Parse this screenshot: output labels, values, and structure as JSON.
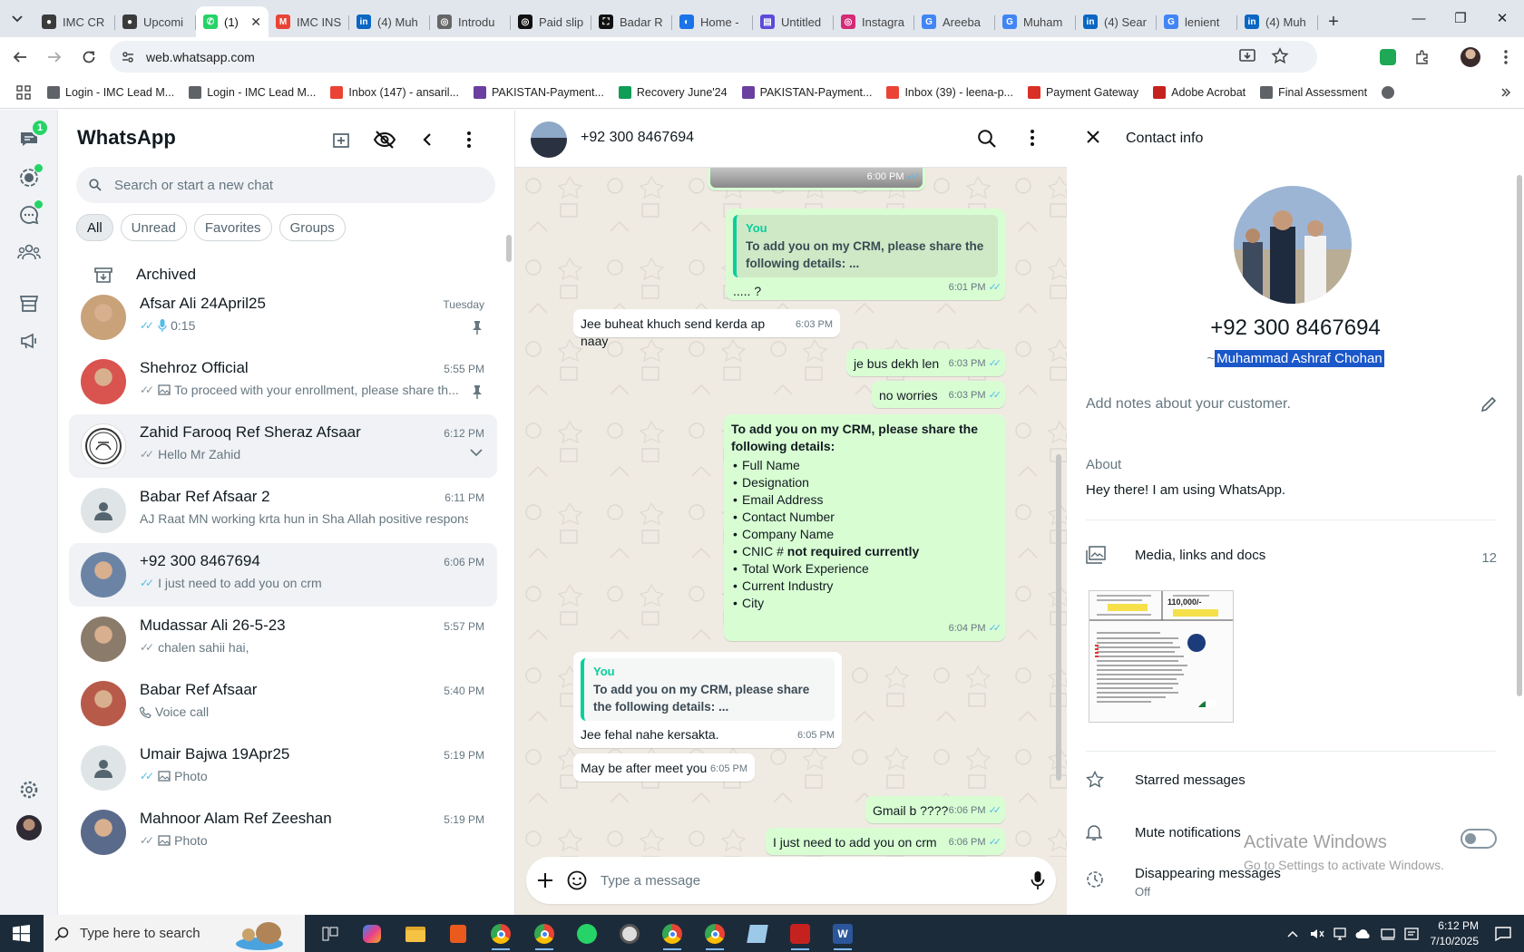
{
  "browser": {
    "tabs": [
      {
        "label": "IMC CR",
        "color": "#3b3b3b",
        "glyph": "●"
      },
      {
        "label": "Upcomi",
        "color": "#3b3b3b",
        "glyph": "●"
      },
      {
        "label": "(1)",
        "color": "#25d366",
        "glyph": "✆",
        "active": true
      },
      {
        "label": "IMC INS",
        "color": "#ea4335",
        "glyph": "M"
      },
      {
        "label": "(4) Muh",
        "color": "#0a66c2",
        "glyph": "in"
      },
      {
        "label": "Introdu",
        "color": "#666",
        "glyph": "◎"
      },
      {
        "label": "Paid slip",
        "color": "#111",
        "glyph": "◎"
      },
      {
        "label": "Badar R",
        "color": "#111",
        "glyph": "⛶"
      },
      {
        "label": "Home -",
        "color": "#1a73e8",
        "glyph": "◐"
      },
      {
        "label": "Untitled",
        "color": "#5b4bdb",
        "glyph": "▤"
      },
      {
        "label": "Instagra",
        "color": "#d62976",
        "glyph": "◎"
      },
      {
        "label": "Areeba",
        "color": "#4285f4",
        "glyph": "G"
      },
      {
        "label": "Muham",
        "color": "#4285f4",
        "glyph": "G"
      },
      {
        "label": "(4) Sear",
        "color": "#0a66c2",
        "glyph": "in"
      },
      {
        "label": "lenient",
        "color": "#4285f4",
        "glyph": "G"
      },
      {
        "label": "(4) Muh",
        "color": "#0a66c2",
        "glyph": "in"
      }
    ],
    "url": "web.whatsapp.com",
    "bookmarks": [
      {
        "label": "Login - IMC Lead M...",
        "color": "#5f6368"
      },
      {
        "label": "Login - IMC Lead M...",
        "color": "#5f6368"
      },
      {
        "label": "Inbox (147) - ansaril...",
        "color": "#ea4335"
      },
      {
        "label": "PAKISTAN-Payment...",
        "color": "#6b3fa0"
      },
      {
        "label": "Recovery June'24",
        "color": "#0f9d58"
      },
      {
        "label": "PAKISTAN-Payment...",
        "color": "#6b3fa0"
      },
      {
        "label": "Inbox (39) - leena-p...",
        "color": "#ea4335"
      },
      {
        "label": "Payment Gateway",
        "color": "#d93025"
      },
      {
        "label": "Adobe Acrobat",
        "color": "#c5221f"
      },
      {
        "label": "Final Assessment",
        "color": "#5f6368"
      }
    ]
  },
  "rail": {
    "badge": "1"
  },
  "chatlist": {
    "title": "WhatsApp",
    "search_placeholder": "Search or start a new chat",
    "filters": [
      "All",
      "Unread",
      "Favorites",
      "Groups"
    ],
    "archived": "Archived",
    "chats": [
      {
        "name": "Afsar Ali 24April25",
        "time": "Tuesday",
        "preview": "0:15",
        "icon": "mic",
        "pinned": true,
        "avatar": "#c9a27a"
      },
      {
        "name": "Shehroz Official",
        "time": "5:55 PM",
        "preview": "To proceed with your enrollment, please share th...",
        "icon": "image",
        "pinned": true,
        "avatar": "#d9534f"
      },
      {
        "name": "Zahid Farooq Ref Sheraz Afsaar",
        "time": "6:12 PM",
        "preview": "Hello Mr Zahid",
        "icon": "ticks",
        "selected": true,
        "avatar": "#f5f5f5"
      },
      {
        "name": "Babar Ref Afsaar 2",
        "time": "6:11 PM",
        "preview": "AJ Raat MN working krta hun in Sha Allah positive respons...",
        "icon": "none",
        "avatar": "#dfe5e7"
      },
      {
        "name": "+92 300 8467694",
        "time": "6:06 PM",
        "preview": "I just need to add you on crm",
        "icon": "ticks-blue",
        "selected": true,
        "avatar": "#6b84a6"
      },
      {
        "name": "Mudassar Ali 26-5-23",
        "time": "5:57 PM",
        "preview": "chalen sahii hai,",
        "icon": "ticks",
        "avatar": "#8b7b6b"
      },
      {
        "name": "Babar Ref Afsaar",
        "time": "5:40 PM",
        "preview": "Voice call",
        "icon": "call",
        "avatar": "#b85a4a"
      },
      {
        "name": "Umair Bajwa 19Apr25",
        "time": "5:19 PM",
        "preview": "Photo",
        "icon": "image-blue",
        "avatar": "#dfe5e7"
      },
      {
        "name": "Mahnoor Alam Ref Zeeshan",
        "time": "5:19 PM",
        "preview": "Photo",
        "icon": "image",
        "avatar": "#5a6a8a"
      }
    ]
  },
  "conversation": {
    "contact": "+92 300 8467694",
    "placeholder": "Type a message",
    "messages": {
      "m0_time": "6:00 PM",
      "m1_qname": "You",
      "m1_qtext": "To add you on my CRM, please share the following details: ...",
      "m1_text": "..... ?",
      "m1_time": "6:01 PM",
      "m2_text": "Jee buheat khuch send kerda ap naay",
      "m2_time": "6:03 PM",
      "m3_text": "je bus dekh len",
      "m3_time": "6:03 PM",
      "m4_text": "no worries",
      "m4_time": "6:03 PM",
      "m5_head": "To add you on my CRM, please share the following details:",
      "m5_items": [
        "Full Name",
        "Designation",
        "Email Address",
        "Contact Number",
        "Company Name"
      ],
      "m5_cnic": "CNIC #",
      "m5_cnic_bold": "not required currently",
      "m5_items2": [
        "Total Work Experience",
        "Current Industry",
        "City"
      ],
      "m5_time": "6:04 PM",
      "m6_qname": "You",
      "m6_qtext": "To add you on my CRM, please share the following details: ...",
      "m6_text": "Jee fehal nahe kersakta.",
      "m6_time": "6:05 PM",
      "m7_text": "May be after meet you",
      "m7_time": "6:05 PM",
      "m8_text": "Gmail b ????",
      "m8_time": "6:06 PM",
      "m9_text": "I just need to add you on crm",
      "m9_time": "6:06 PM"
    }
  },
  "contact_info": {
    "title": "Contact info",
    "phone": "+92 300 8467694",
    "push_prefix": "~",
    "push_name": "Muhammad Ashraf Chohan",
    "notes_placeholder": "Add notes about your customer.",
    "about_label": "About",
    "about_value": "Hey there! I am using WhatsApp.",
    "media_label": "Media, links and docs",
    "media_count": "12",
    "starred": "Starred messages",
    "mute": "Mute notifications",
    "disappearing": "Disappearing messages",
    "disappearing_state": "Off",
    "thumb_price": "110,000/-"
  },
  "watermark": {
    "title": "Activate Windows",
    "subtitle": "Go to Settings to activate Windows."
  },
  "taskbar": {
    "search": "Type here to search",
    "time": "6:12 PM",
    "date": "7/10/2025"
  }
}
